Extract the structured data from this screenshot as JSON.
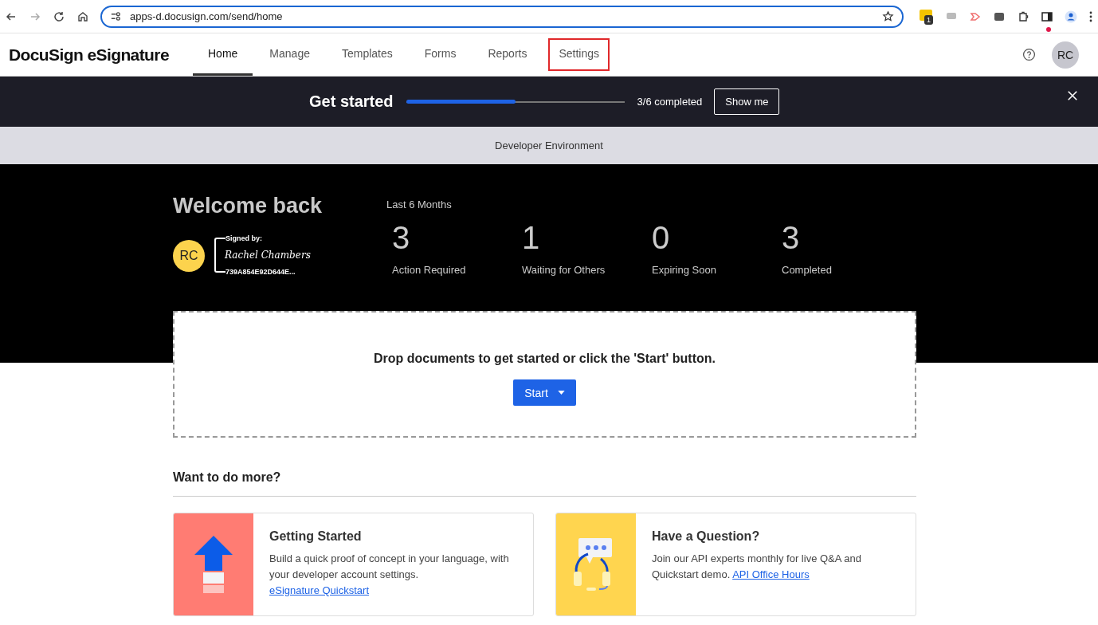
{
  "browser": {
    "url": "apps-d.docusign.com/send/home",
    "extension_badge": "1"
  },
  "header": {
    "logo": "DocuSign eSignature",
    "tabs": [
      {
        "label": "Home",
        "selected": true,
        "highlighted": false
      },
      {
        "label": "Manage",
        "selected": false,
        "highlighted": false
      },
      {
        "label": "Templates",
        "selected": false,
        "highlighted": false
      },
      {
        "label": "Forms",
        "selected": false,
        "highlighted": false
      },
      {
        "label": "Reports",
        "selected": false,
        "highlighted": false
      },
      {
        "label": "Settings",
        "selected": false,
        "highlighted": true
      }
    ],
    "avatar": "RC",
    "notification_dot": true
  },
  "get_started": {
    "title": "Get started",
    "level": 0.5,
    "progress_text": "3/6 completed",
    "button": "Show me"
  },
  "environment_banner": "Developer Environment",
  "welcome": {
    "title": "Welcome back",
    "avatar": "RC",
    "signed_by_label": "Signed by:",
    "signature": "Rachel Chambers",
    "signature_id": "739A854E92D644E...",
    "period": "Last 6 Months",
    "stats": [
      {
        "value": "3",
        "label": "Action Required"
      },
      {
        "value": "1",
        "label": "Waiting for Others"
      },
      {
        "value": "0",
        "label": "Expiring Soon"
      },
      {
        "value": "3",
        "label": "Completed"
      }
    ]
  },
  "dropzone": {
    "text": "Drop documents to get started or click the 'Start' button.",
    "button": "Start"
  },
  "more": {
    "title": "Want to do more?",
    "cards": [
      {
        "kind": "upload",
        "title": "Getting Started",
        "text": "Build a quick proof of concept in your language, with your developer account settings.",
        "link": "eSignature Quickstart"
      },
      {
        "kind": "support",
        "title": "Have a Question?",
        "text": "Join our API experts monthly for live Q&A and Quickstart demo.",
        "link": "API Office Hours"
      }
    ]
  }
}
